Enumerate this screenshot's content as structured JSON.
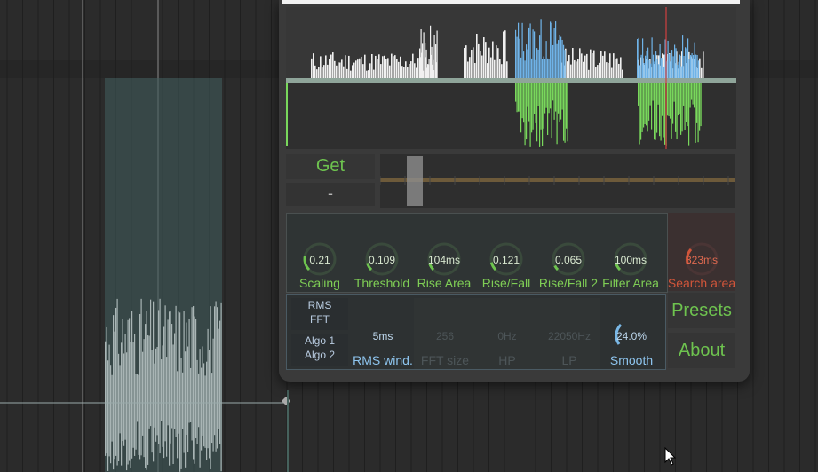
{
  "colors": {
    "accent_green": "#6ec34f",
    "accent_blue": "#7ab8e6",
    "accent_red": "#c0503a",
    "background": "#2a2a2a"
  },
  "detector": {
    "get_label": "Get",
    "status_label": "-"
  },
  "knobs": [
    {
      "value": "0.21",
      "label": "Scaling",
      "level": 0.21
    },
    {
      "value": "0.109",
      "label": "Threshold",
      "level": 0.11
    },
    {
      "value": "104ms",
      "label": "Rise Area",
      "level": 0.1
    },
    {
      "value": "0.121",
      "label": "Rise/Fall",
      "level": 0.12
    },
    {
      "value": "0.065",
      "label": "Rise/Fall 2",
      "level": 0.07
    },
    {
      "value": "100ms",
      "label": "Filter Area",
      "level": 0.1
    }
  ],
  "search": {
    "value": "323ms",
    "label": "Search area",
    "level": 0.3
  },
  "algo": {
    "mode_a": "RMS",
    "mode_b": "FFT",
    "algo_a": "Algo 1",
    "algo_b": "Algo 2"
  },
  "analysis_knobs": [
    {
      "value": "5ms",
      "label": "RMS wind.",
      "active": true
    },
    {
      "value": "256",
      "label": "FFT size",
      "active": false
    },
    {
      "value": "0Hz",
      "label": "HP",
      "active": false
    },
    {
      "value": "22050Hz",
      "label": "LP",
      "active": false
    },
    {
      "value": "24.0%",
      "label": "Smooth",
      "active": true,
      "level": 0.24
    }
  ],
  "side_buttons": {
    "presets": "Presets",
    "about": "About"
  }
}
